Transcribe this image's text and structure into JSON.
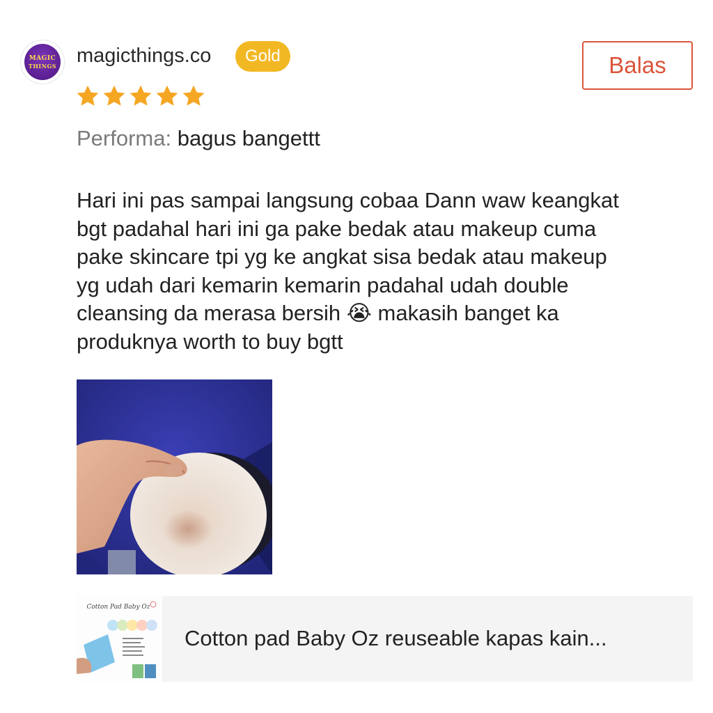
{
  "reviewer": {
    "avatar_text_line1": "MAGIC",
    "avatar_text_line2": "THINGS",
    "username": "magicthings.co",
    "badge": "Gold"
  },
  "reply_button": {
    "label": "Balas"
  },
  "rating": {
    "stars": 5,
    "max": 5,
    "star_color": "#f5a623"
  },
  "performance": {
    "label": "Performa:",
    "value": "bagus bangettt"
  },
  "review_text": "Hari ini pas sampai langsung cobaa Dann waw keangkat\nbgt padahal hari ini ga pake bedak atau makeup cuma\npake skincare tpi yg ke angkat sisa bedak atau makeup\nyg udah dari kemarin kemarin padahal udah double\ncleansing da merasa bersih 😭 makasih banget ka\nproduknya worth to buy bgtt",
  "review_photo": {
    "icon": "review-photo-cotton-pad"
  },
  "product": {
    "thumbnail_title": "Cotton Pad Baby Oz",
    "name": "Cotton pad Baby Oz reuseable kapas kain..."
  },
  "colors": {
    "accent": "#d9553a",
    "badge": "#f2b824",
    "product_bg": "#f4f4f4"
  }
}
